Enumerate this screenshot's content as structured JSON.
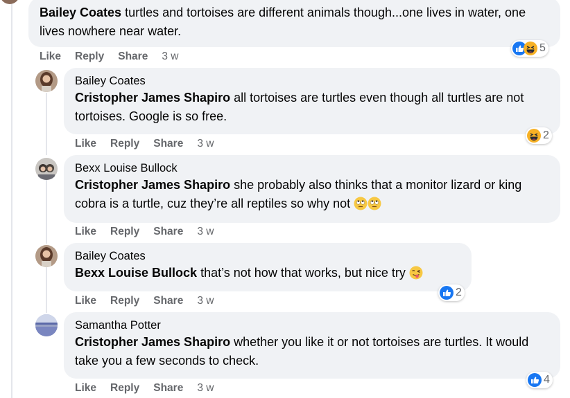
{
  "top_comment": {
    "author": "Bailey Coates",
    "text": "turtles and tortoises are different animals though...one lives in water, one lives nowhere near water.",
    "actions": {
      "like": "Like",
      "reply": "Reply",
      "share": "Share",
      "time": "3 w"
    },
    "reactions": {
      "icons": [
        "like-icon",
        "haha-icon"
      ],
      "count": "5"
    }
  },
  "replies": [
    {
      "author": "Bailey Coates",
      "mention": "Cristopher James Shapiro",
      "text": "all tortoises are turtles even though all turtles are not tortoises. Google is so free.",
      "actions": {
        "like": "Like",
        "reply": "Reply",
        "share": "Share",
        "time": "3 w"
      },
      "reactions": {
        "icons": [
          "haha-icon"
        ],
        "count": "2"
      }
    },
    {
      "author": "Bexx Louise Bullock",
      "mention": "Cristopher James Shapiro",
      "text": "she probably also thinks that a monitor lizard or king cobra is a turtle, cuz they’re all reptiles so why not",
      "emojis": [
        "rolling-eyes-emoji",
        "rolling-eyes-emoji"
      ],
      "actions": {
        "like": "Like",
        "reply": "Reply",
        "share": "Share",
        "time": "3 w"
      }
    },
    {
      "author": "Bailey Coates",
      "mention": "Bexx Louise Bullock",
      "text": "that’s not how that works, but nice try",
      "emojis": [
        "winking-tongue-emoji"
      ],
      "actions": {
        "like": "Like",
        "reply": "Reply",
        "share": "Share",
        "time": "3 w"
      },
      "reactions": {
        "icons": [
          "like-icon"
        ],
        "count": "2"
      }
    },
    {
      "author": "Samantha Potter",
      "mention": "Cristopher James Shapiro",
      "text": "whether you like it or not tortoises are turtles. It would take you a few seconds to check.",
      "actions": {
        "like": "Like",
        "reply": "Reply",
        "share": "Share",
        "time": "3 w"
      },
      "reactions": {
        "icons": [
          "like-icon"
        ],
        "count": "4"
      }
    }
  ],
  "colors": {
    "bubble": "#f0f2f5",
    "meta": "#65676b",
    "like_blue": "#1877f2",
    "haha_yellow": "#f7b125"
  }
}
